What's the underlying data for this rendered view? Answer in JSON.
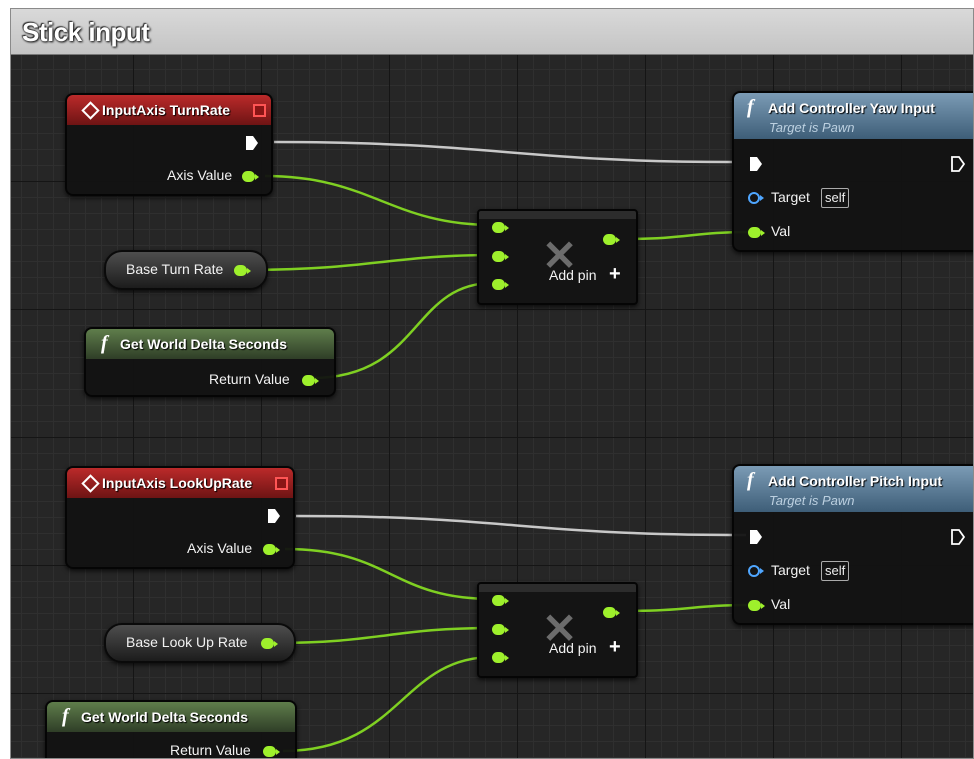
{
  "title": "Stick input",
  "icons": {
    "event": "diamond-icon",
    "event_toggle": "red-square-icon",
    "function": "function-f-icon",
    "multiply": "multiply-x-icon",
    "add": "plus-icon",
    "exec": "exec-arrow-icon"
  },
  "colors": {
    "float_pin": "#9ef02c",
    "object_pin": "#4fa6ff",
    "event_header": "#bb2a2a",
    "pure_function_header": "#5f7d4b",
    "function_header": "#7b9bb5"
  },
  "turn": {
    "event": {
      "title": "InputAxis TurnRate",
      "axis_value": "Axis Value"
    },
    "variable": {
      "label": "Base Turn Rate"
    },
    "delta": {
      "title": "Get World Delta Seconds",
      "return_value": "Return Value"
    },
    "multiply": {
      "add_pin": "Add pin"
    },
    "add_input": {
      "title": "Add Controller Yaw Input",
      "subtitle": "Target is Pawn",
      "target": "Target",
      "self": "self",
      "val": "Val"
    }
  },
  "lookup": {
    "event": {
      "title": "InputAxis LookUpRate",
      "axis_value": "Axis Value"
    },
    "variable": {
      "label": "Base Look Up Rate"
    },
    "delta": {
      "title": "Get World Delta Seconds",
      "return_value": "Return Value"
    },
    "multiply": {
      "add_pin": "Add pin"
    },
    "add_input": {
      "title": "Add Controller Pitch Input",
      "subtitle": "Target is Pawn",
      "target": "Target",
      "self": "self",
      "val": "Val"
    }
  }
}
